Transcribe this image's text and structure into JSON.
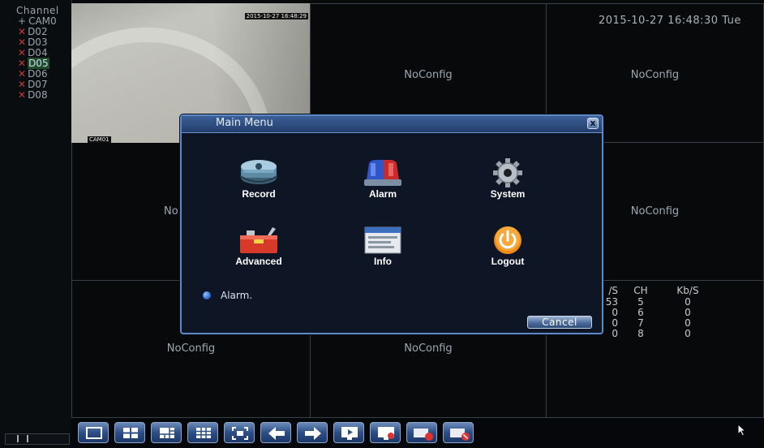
{
  "channel_panel": {
    "title": "Channel",
    "items": [
      {
        "prefix": "+",
        "label": "CAM0",
        "state": "connected"
      },
      {
        "prefix": "x",
        "label": "D02",
        "state": "disconnected"
      },
      {
        "prefix": "x",
        "label": "D03",
        "state": "disconnected"
      },
      {
        "prefix": "x",
        "label": "D04",
        "state": "disconnected"
      },
      {
        "prefix": "x",
        "label": "D05",
        "state": "disconnected"
      },
      {
        "prefix": "x",
        "label": "D06",
        "state": "disconnected"
      },
      {
        "prefix": "x",
        "label": "D07",
        "state": "disconnected"
      },
      {
        "prefix": "x",
        "label": "D08",
        "state": "disconnected"
      }
    ]
  },
  "camera": {
    "timestamp": "2015-10-27 16:48:29",
    "name": "CAM01"
  },
  "datetime": "2015-10-27 16:48:30 Tue",
  "grid": {
    "noconfig_label": "NoConfig",
    "left_partial_label": "No"
  },
  "stats": {
    "headers": [
      "/S",
      "CH",
      "Kb/S"
    ],
    "rows": [
      [
        "53",
        "5",
        "0"
      ],
      [
        "0",
        "6",
        "0"
      ],
      [
        "0",
        "7",
        "0"
      ],
      [
        "0",
        "8",
        "0"
      ]
    ]
  },
  "dialog": {
    "title": "Main Menu",
    "close_symbol": "x",
    "items": [
      {
        "label": "Record",
        "icon": "record-icon"
      },
      {
        "label": "Alarm",
        "icon": "alarm-siren-icon"
      },
      {
        "label": "System",
        "icon": "gear-icon"
      },
      {
        "label": "Advanced",
        "icon": "toolbox-icon"
      },
      {
        "label": "Info",
        "icon": "info-window-icon"
      },
      {
        "label": "Logout",
        "icon": "power-icon"
      }
    ],
    "status_text": "Alarm.",
    "cancel_label": "Cancel"
  },
  "colors": {
    "dialog_border": "#5e87c4",
    "dialog_bg": "#0e1524",
    "disconnected_mark": "#c23a3a",
    "toolbar_button": "#2d4f86"
  },
  "toolbar": {
    "buttons": [
      {
        "icon": "single-view-icon"
      },
      {
        "icon": "quad-view-icon"
      },
      {
        "icon": "six-view-icon"
      },
      {
        "icon": "nine-view-icon"
      },
      {
        "icon": "fullscreen-icon"
      },
      {
        "icon": "previous-arrow-icon"
      },
      {
        "icon": "next-arrow-icon"
      },
      {
        "icon": "playback-icon"
      },
      {
        "icon": "ptz-icon"
      },
      {
        "icon": "record-stop-icon"
      },
      {
        "icon": "alarm-stop-icon"
      }
    ]
  }
}
